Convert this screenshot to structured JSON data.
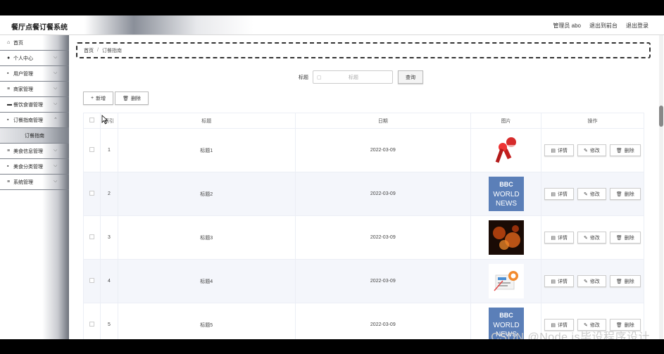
{
  "app": {
    "title": "餐厅点餐订餐系统"
  },
  "header": {
    "user": "管理员 abo",
    "front_link": "退出到前台",
    "logout": "退出登录"
  },
  "sidebar": {
    "items": [
      {
        "label": "首页",
        "icon": "home-icon",
        "glyph": "⌂"
      },
      {
        "label": "个人中心",
        "icon": "user-icon",
        "glyph": "●"
      },
      {
        "label": "用户管理",
        "icon": "grid-icon",
        "glyph": "▪"
      },
      {
        "label": "商家管理",
        "icon": "list-icon",
        "glyph": "≡"
      },
      {
        "label": "餐饮食谱管理",
        "icon": "card-icon",
        "glyph": "▬"
      },
      {
        "label": "订餐指南管理",
        "icon": "grid-icon",
        "glyph": "▪"
      },
      {
        "label": "美食信息管理",
        "icon": "menu-icon",
        "glyph": "≡"
      },
      {
        "label": "美食分类管理",
        "icon": "grid-icon",
        "glyph": "▪"
      },
      {
        "label": "系统管理",
        "icon": "menu-icon",
        "glyph": "≡"
      }
    ],
    "sub_item": "订餐指南"
  },
  "breadcrumb": {
    "home": "首页",
    "separator": "/",
    "current": "订餐指南"
  },
  "search": {
    "label": "标题",
    "placeholder": "标题",
    "button": "查询"
  },
  "actions": {
    "add": "新增",
    "delete": "删除"
  },
  "table": {
    "columns": [
      "索引",
      "标题",
      "日期",
      "图片",
      "操作"
    ],
    "rows": [
      {
        "index": "1",
        "title": "标题1",
        "date": "2022-03-09",
        "image": "microphone"
      },
      {
        "index": "2",
        "title": "标题2",
        "date": "2022-03-09",
        "image": "bbc"
      },
      {
        "index": "3",
        "title": "标题3",
        "date": "2022-03-09",
        "image": "fire"
      },
      {
        "index": "4",
        "title": "标题4",
        "date": "2022-03-09",
        "image": "newspaper"
      },
      {
        "index": "5",
        "title": "标题5",
        "date": "2022-03-09",
        "image": "bbc"
      }
    ],
    "op_labels": {
      "detail": "详情",
      "edit": "修改",
      "delete": "删除"
    }
  },
  "bbc": {
    "logo": "BBC",
    "world": "WORLD",
    "news": "NEWS"
  },
  "watermark": "CSDN @Node.js毕设程序设计"
}
